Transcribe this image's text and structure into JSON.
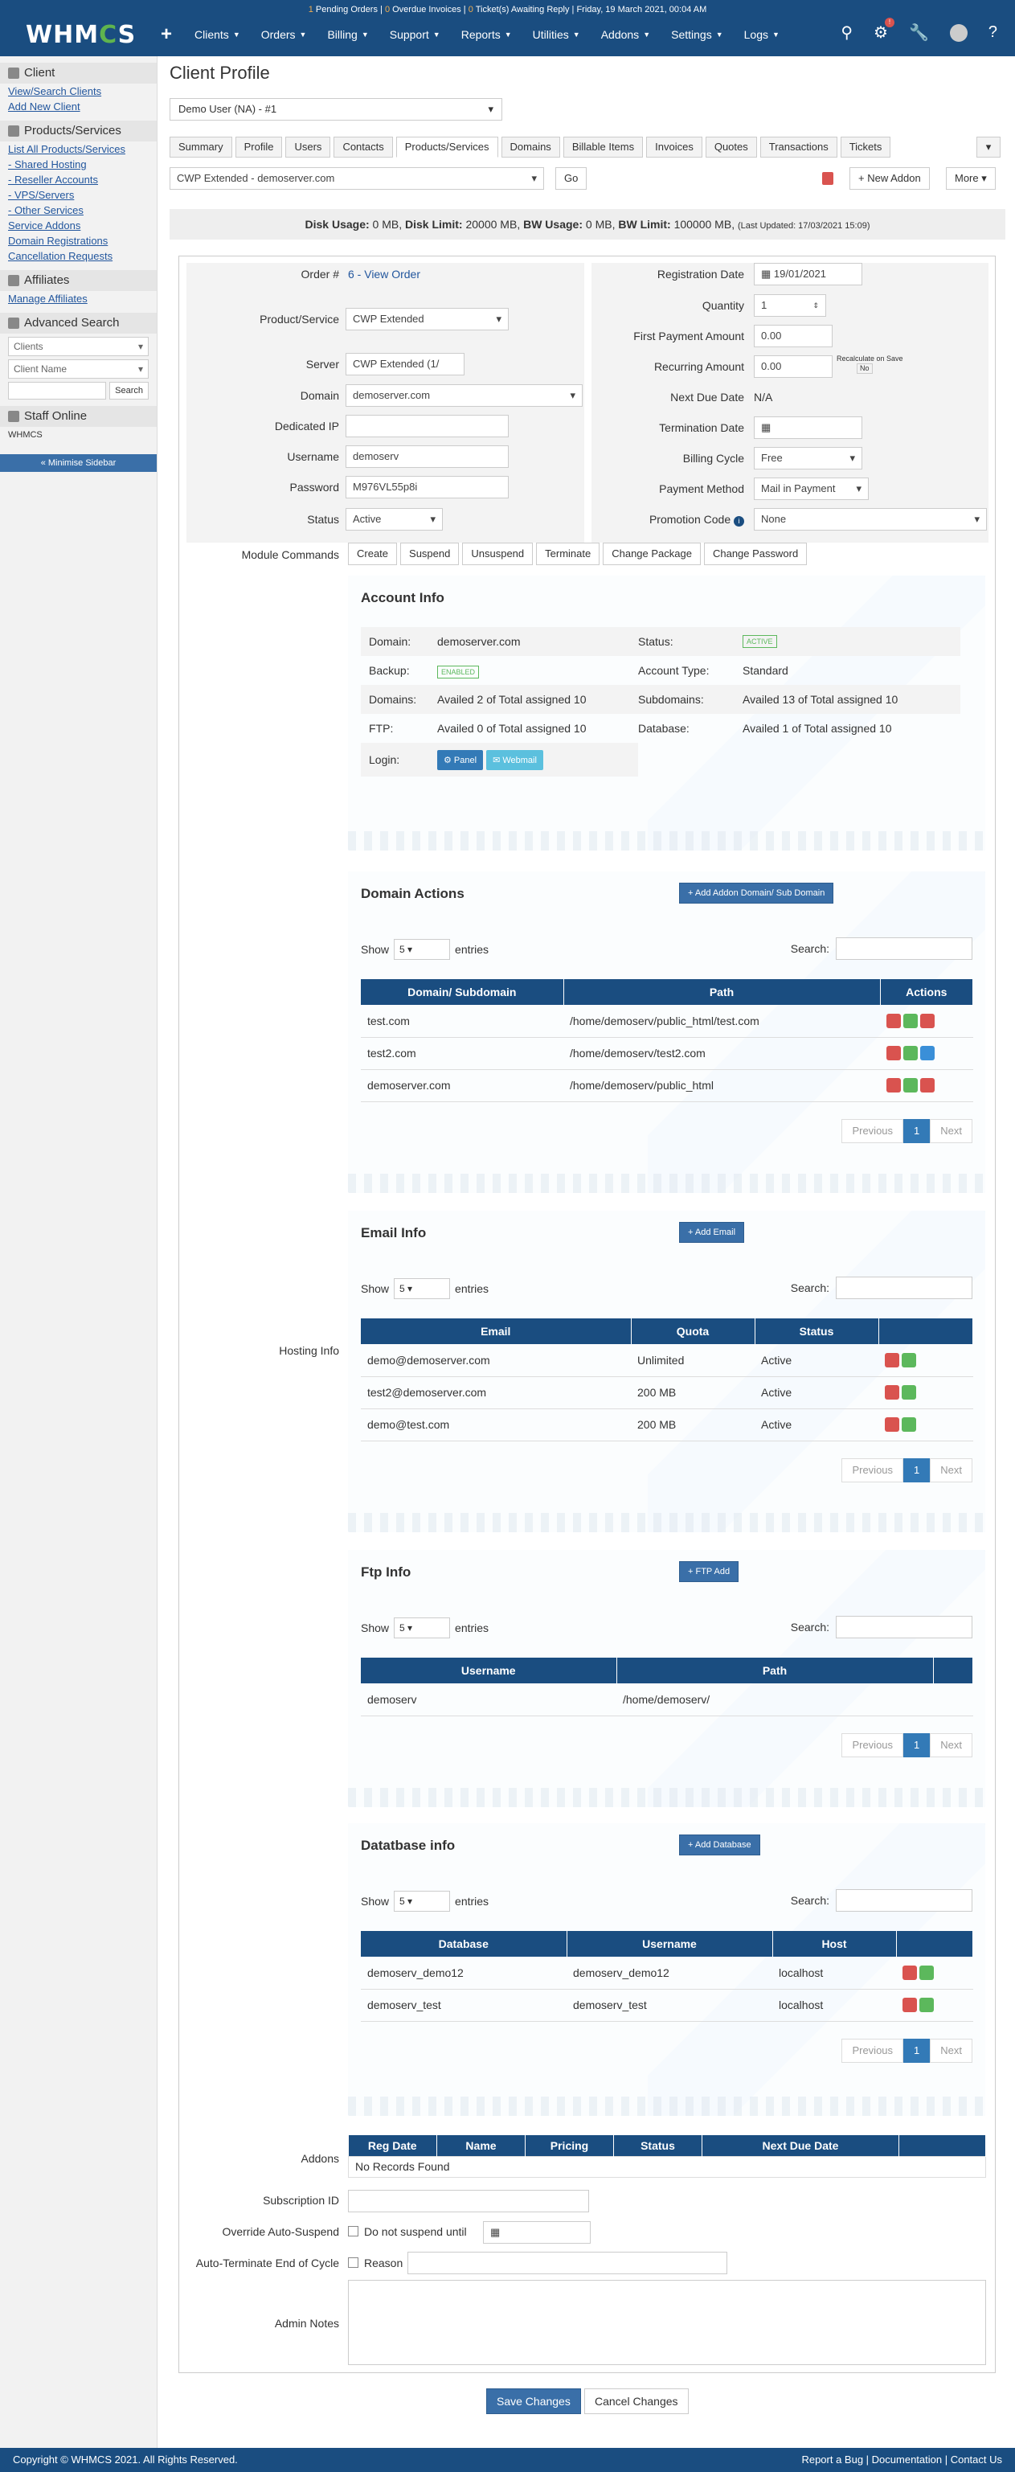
{
  "notice": {
    "pending_count": "1",
    "pending": "Pending Orders",
    "overdue_count": "0",
    "overdue": "Overdue Invoices",
    "tickets_count": "0",
    "tickets": "Ticket(s) Awaiting Reply",
    "date": "Friday, 19 March 2021, 00:04 AM"
  },
  "brand": "WHMCS",
  "nav": [
    "Clients",
    "Orders",
    "Billing",
    "Support",
    "Reports",
    "Utilities",
    "Addons",
    "Settings",
    "Logs"
  ],
  "sidebar": {
    "clients_title": "Client",
    "clients_links": [
      "View/Search Clients",
      "Add New Client"
    ],
    "ps_title": "Products/Services",
    "ps_links": [
      "List All Products/Services",
      "- Shared Hosting",
      "- Reseller Accounts",
      "- VPS/Servers",
      "- Other Services",
      "Service Addons",
      "Domain Registrations",
      "Cancellation Requests"
    ],
    "aff_title": "Affiliates",
    "aff_links": [
      "Manage Affiliates"
    ],
    "adv_title": "Advanced Search",
    "adv_sel1": "Clients",
    "adv_sel2": "Client Name",
    "adv_search": "Search",
    "staff_title": "Staff Online",
    "staff_name": "WHMCS",
    "minimise": "« Minimise Sidebar"
  },
  "page": {
    "title": "Client Profile",
    "client_select": "Demo User (NA) - #1"
  },
  "tabs": [
    "Summary",
    "Profile",
    "Users",
    "Contacts",
    "Products/Services",
    "Domains",
    "Billable Items",
    "Invoices",
    "Quotes",
    "Transactions",
    "Tickets"
  ],
  "service_select": "CWP Extended - demoserver.com",
  "go": "Go",
  "new_addon": "New Addon",
  "more": "More",
  "usage": {
    "disk_label": "Disk Usage:",
    "disk": "0 MB",
    "limit_label": "Disk Limit:",
    "limit": "20000 MB",
    "bw_label": "BW Usage:",
    "bw": "0 MB",
    "bwl_label": "BW Limit:",
    "bwl": "100000 MB",
    "updated": "(Last Updated: 17/03/2021 15:09)"
  },
  "form": {
    "order_label": "Order #",
    "order": "6 - View Order",
    "prod_label": "Product/Service",
    "prod": "CWP Extended",
    "server_label": "Server",
    "server": "CWP Extended (1/",
    "domain_label": "Domain",
    "domain": "demoserver.com",
    "ip_label": "Dedicated IP",
    "user_label": "Username",
    "user": "demoserv",
    "pass_label": "Password",
    "pass": "M976VL55p8i",
    "status_label": "Status",
    "status": "Active",
    "reg_label": "Registration Date",
    "reg": "19/01/2021",
    "qty_label": "Quantity",
    "qty": "1",
    "fpa_label": "First Payment Amount",
    "fpa": "0.00",
    "rec_label": "Recurring Amount",
    "rec": "0.00",
    "recalc": "Recalculate on Save",
    "recalc_val": "No",
    "ndd_label": "Next Due Date",
    "ndd": "N/A",
    "term_label": "Termination Date",
    "cycle_label": "Billing Cycle",
    "cycle": "Free",
    "pm_label": "Payment Method",
    "pm": "Mail in Payment",
    "promo_label": "Promotion Code",
    "promo": "None",
    "mod_label": "Module Commands",
    "modules": [
      "Create",
      "Suspend",
      "Unsuspend",
      "Terminate",
      "Change Package",
      "Change Password"
    ],
    "hosting_label": "Hosting Info"
  },
  "account": {
    "title": "Account Info",
    "rows": [
      [
        "Domain:",
        "demoserver.com",
        "Status:",
        "ACTIVE"
      ],
      [
        "Backup:",
        "ENABLED",
        "Account Type:",
        "Standard"
      ],
      [
        "Domains:",
        "Availed 2 of Total assigned 10",
        "Subdomains:",
        "Availed 13 of Total assigned 10"
      ],
      [
        "FTP:",
        "Availed 0 of Total assigned 10",
        "Database:",
        "Availed 1 of Total assigned 10"
      ]
    ],
    "login": "Login:",
    "panel": "Panel",
    "webmail": "Webmail"
  },
  "domain_actions": {
    "title": "Domain Actions",
    "add": "+ Add Addon Domain/ Sub Domain",
    "cols": [
      "Domain/ Subdomain",
      "Path",
      "Actions"
    ],
    "rows": [
      [
        "test.com",
        "/home/demoserv/public_html/test.com"
      ],
      [
        "test2.com",
        "/home/demoserv/test2.com"
      ],
      [
        "demoserver.com",
        "/home/demoserv/public_html"
      ]
    ]
  },
  "email": {
    "title": "Email Info",
    "add": "+ Add Email",
    "cols": [
      "Email",
      "Quota",
      "Status"
    ],
    "rows": [
      [
        "demo@demoserver.com",
        "Unlimited",
        "Active"
      ],
      [
        "test2@demoserver.com",
        "200 MB",
        "Active"
      ],
      [
        "demo@test.com",
        "200 MB",
        "Active"
      ]
    ]
  },
  "ftp": {
    "title": "Ftp Info",
    "add": "+ FTP Add",
    "cols": [
      "Username",
      "Path"
    ],
    "rows": [
      [
        "demoserv",
        "/home/demoserv/"
      ]
    ]
  },
  "db": {
    "title": "Datatbase info",
    "add": "+ Add Database",
    "cols": [
      "Database",
      "Username",
      "Host"
    ],
    "rows": [
      [
        "demoserv_demo12",
        "demoserv_demo12",
        "localhost"
      ],
      [
        "demoserv_test",
        "demoserv_test",
        "localhost"
      ]
    ]
  },
  "tablectl": {
    "show": "Show",
    "entries": "entries",
    "len": "5",
    "search": "Search:",
    "prev": "Previous",
    "page": "1",
    "next": "Next"
  },
  "addons": {
    "label": "Addons",
    "cols": [
      "Reg Date",
      "Name",
      "Pricing",
      "Status",
      "Next Due Date"
    ],
    "empty": "No Records Found"
  },
  "bottom": {
    "sub_label": "Subscription ID",
    "override_label": "Override Auto-Suspend",
    "override_opt": "Do not suspend until",
    "autoterm_label": "Auto-Terminate End of Cycle",
    "reason": "Reason",
    "notes_label": "Admin Notes",
    "save": "Save Changes",
    "cancel": "Cancel Changes"
  },
  "footer": {
    "copy": "Copyright © WHMCS 2021. All Rights Reserved.",
    "links": "Report a Bug | Documentation | Contact Us"
  }
}
